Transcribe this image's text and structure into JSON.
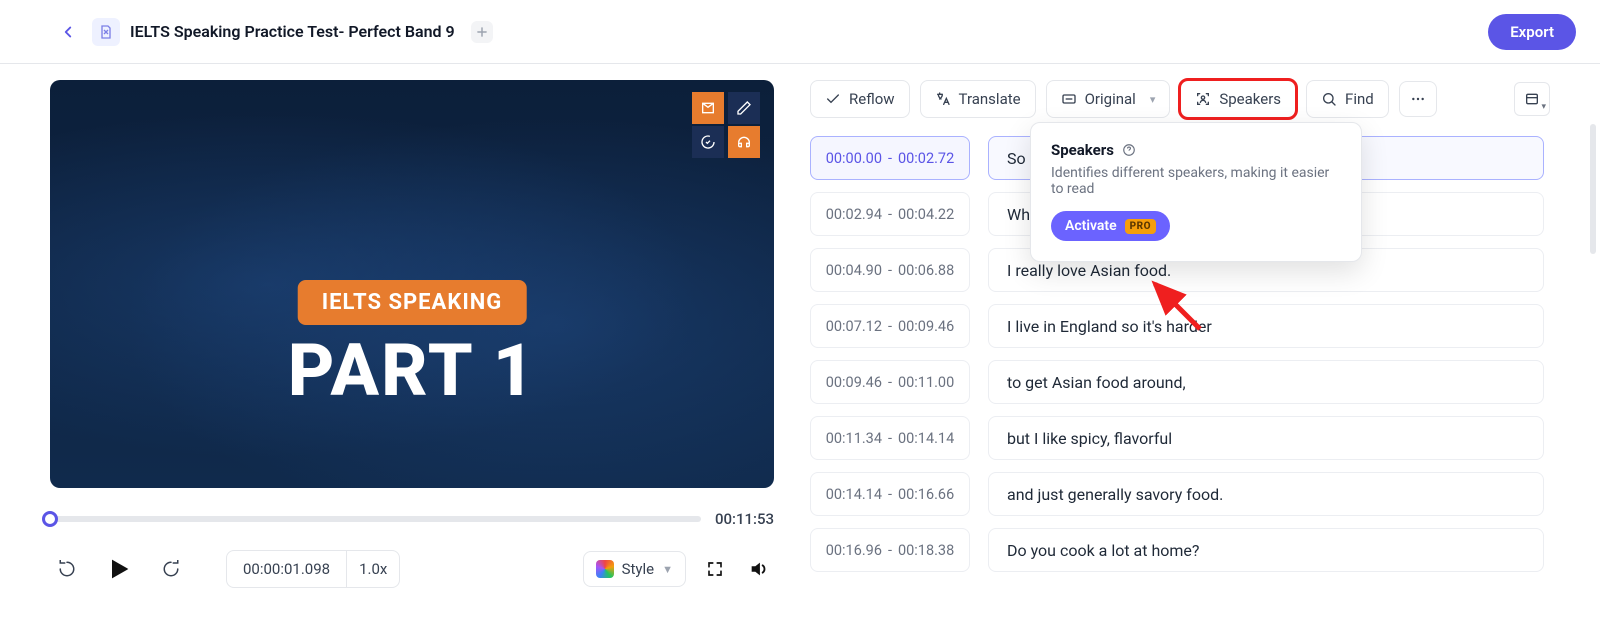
{
  "header": {
    "title": "IELTS Speaking Practice Test- Perfect Band 9",
    "export_label": "Export"
  },
  "video": {
    "tag": "IELTS SPEAKING",
    "big_title": "PART 1",
    "current_time": "00:00:01.098",
    "playback_rate": "1.0x",
    "total_duration": "00:11:53",
    "style_label": "Style"
  },
  "toolbar": {
    "reflow": "Reflow",
    "translate": "Translate",
    "original": "Original",
    "speakers": "Speakers",
    "find": "Find"
  },
  "popover": {
    "title": "Speakers",
    "desc": "Identifies different speakers, making it easier to read",
    "activate": "Activate",
    "pro": "PRO"
  },
  "rows": [
    {
      "start": "00:00.00",
      "end": "00:02.72",
      "text": "So let",
      "active": true
    },
    {
      "start": "00:02.94",
      "end": "00:04.22",
      "text": "What'"
    },
    {
      "start": "00:04.90",
      "end": "00:06.88",
      "text": "I really love Asian food."
    },
    {
      "start": "00:07.12",
      "end": "00:09.46",
      "text": "I live in England so it's harder"
    },
    {
      "start": "00:09.46",
      "end": "00:11.00",
      "text": "to get Asian food around,"
    },
    {
      "start": "00:11.34",
      "end": "00:14.14",
      "text": "but I like spicy, flavorful"
    },
    {
      "start": "00:14.14",
      "end": "00:16.66",
      "text": "and just generally savory food."
    },
    {
      "start": "00:16.96",
      "end": "00:18.38",
      "text": "Do you cook a lot at home?"
    }
  ]
}
